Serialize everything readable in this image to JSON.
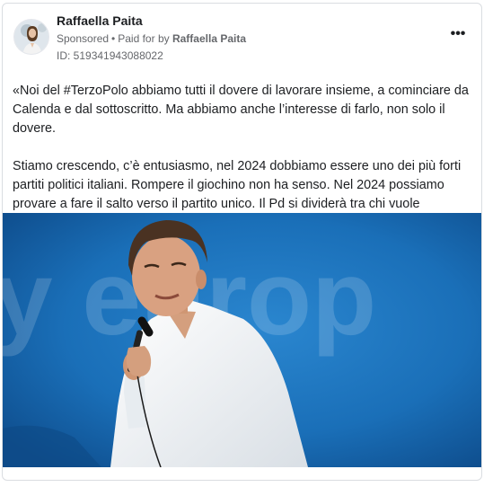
{
  "post": {
    "author": "Raffaella Paita",
    "sponsored_label": "Sponsored",
    "separator": "•",
    "paid_for_by_label": "Paid for by",
    "payer": "Raffaella Paita",
    "ad_id": "ID: 519341943088022",
    "more_icon": "more-horizontal-icon",
    "paragraph_1": "«Noi del #TerzoPolo abbiamo tutti il dovere di lavorare insieme, a cominciare da Calenda e dal sottoscritto. Ma abbiamo anche l’interesse di farlo, non solo il dovere.",
    "paragraph_2": "Stiamo crescendo, c’è entusiasmo, nel 2024 dobbiamo essere uno dei più forti partiti politici italiani. Rompere il giochino non ha senso. Nel 2024 possiamo provare a fare il salto verso il partito unico. Il Pd si dividerà tra chi vuole inseguire…",
    "image_background_text": "y europ"
  },
  "colors": {
    "text_primary": "#1c1e21",
    "text_secondary": "#65676b",
    "border": "#dadde1",
    "photo_bg": "#1a6fb8",
    "shirt": "#f4f6f8"
  }
}
